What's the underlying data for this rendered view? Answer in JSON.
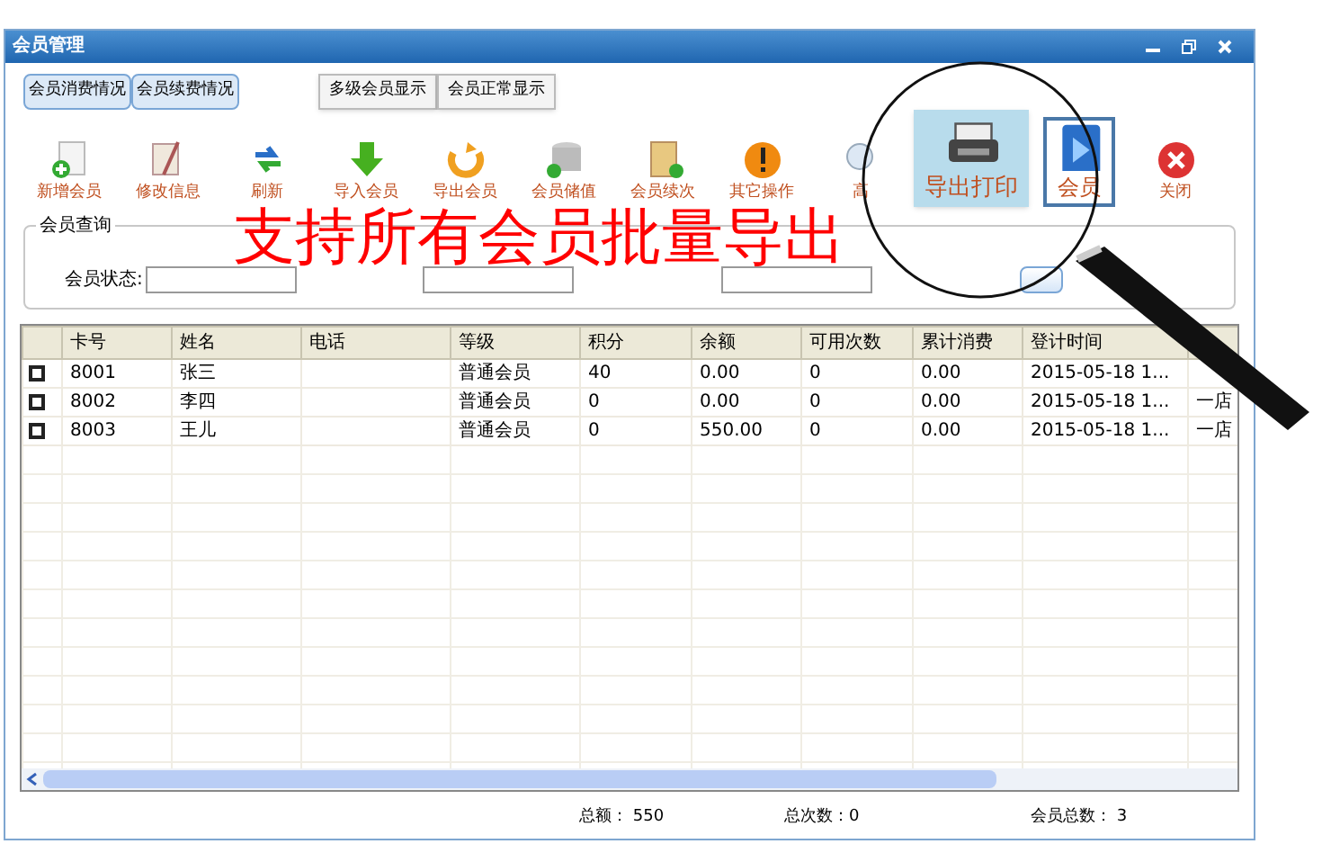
{
  "window": {
    "title": "会员管理"
  },
  "top_buttons": [
    {
      "label": "会员消费情况",
      "kind": "blue"
    },
    {
      "label": "会员续费情况",
      "kind": "blue"
    },
    {
      "label": "多级会员显示",
      "kind": "plain"
    },
    {
      "label": "会员正常显示",
      "kind": "plain"
    }
  ],
  "toolbar": [
    {
      "label": "新增会员",
      "kind": "normal"
    },
    {
      "label": "修改信息",
      "kind": "normal"
    },
    {
      "label": "刷新",
      "kind": "normal"
    },
    {
      "label": "导入会员",
      "kind": "normal"
    },
    {
      "label": "导出会员",
      "kind": "normal"
    },
    {
      "label": "会员储值",
      "kind": "normal"
    },
    {
      "label": "会员续次",
      "kind": "normal"
    },
    {
      "label": "其它操作",
      "kind": "normal"
    },
    {
      "label": "高",
      "kind": "normal"
    },
    {
      "label": "导出打印",
      "kind": "magnified"
    },
    {
      "label": "会员",
      "kind": "magnified_boxed"
    },
    {
      "label": "关闭",
      "kind": "normal"
    }
  ],
  "query": {
    "title": "会员查询",
    "status_label": "会员状态:"
  },
  "caption": "支持所有会员批量导出",
  "table": {
    "columns": [
      "卡号",
      "姓名",
      "电话",
      "等级",
      "积分",
      "余额",
      "可用次数",
      "累计消费",
      "登计时间"
    ],
    "rows": [
      {
        "checked": false,
        "cells": [
          "8001",
          "张三",
          "",
          "普通会员",
          "40",
          "0.00",
          "0",
          "0.00",
          "2015-05-18 1...",
          ""
        ]
      },
      {
        "checked": false,
        "cells": [
          "8002",
          "李四",
          "",
          "普通会员",
          "0",
          "0.00",
          "0",
          "0.00",
          "2015-05-18 1...",
          "一店"
        ]
      },
      {
        "checked": false,
        "cells": [
          "8003",
          "王儿",
          "",
          "普通会员",
          "0",
          "550.00",
          "0",
          "0.00",
          "2015-05-18 1...",
          "一店"
        ]
      }
    ]
  },
  "status_bar": [
    "总额： 550",
    "总次数：0",
    "会员总数： 3"
  ]
}
